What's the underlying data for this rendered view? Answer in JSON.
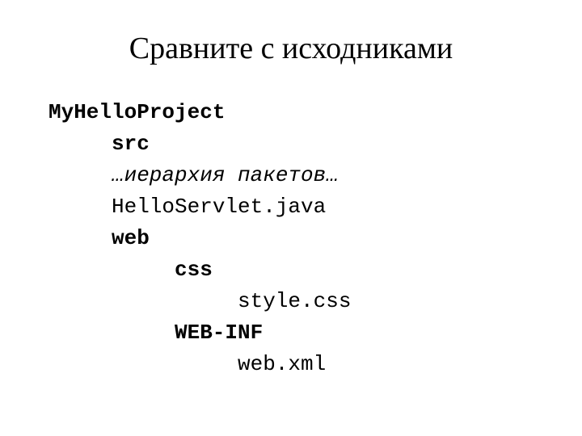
{
  "title": "Сравните с исходниками",
  "tree": {
    "project": "MyHelloProject",
    "src": "src",
    "packages": "…иерархия пакетов…",
    "servlet": "HelloServlet.java",
    "web": "web",
    "css": "css",
    "stylecss": "style.css",
    "webinf": "WEB-INF",
    "webxml": "web.xml"
  }
}
